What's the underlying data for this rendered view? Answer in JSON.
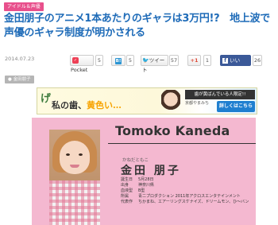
{
  "article": {
    "category": "アイドル＆声優",
    "title": "金田朋子のアニメ1本あたりのギャラは3万円!?　地上波で声優のギャラ制度が明かされる",
    "date": "2014.07.23",
    "tag": "金田朋子"
  },
  "share": {
    "pocket": {
      "label": "Pocket",
      "count": "5"
    },
    "hatena": {
      "icon": "B!",
      "count": "5"
    },
    "tweet": {
      "label": "ツイート",
      "count": "57"
    },
    "gplus": {
      "label": "+1",
      "count": "1"
    },
    "facebook": {
      "label": "いいね！",
      "count": "26"
    }
  },
  "ad": {
    "ke": "げ",
    "line_prefix": "私の歯、",
    "line_highlight": "黄色い…",
    "notice": "歯が黄ばんでいる人限定!!",
    "subtext": "京都やまみち",
    "button": "詳しくはこちら"
  },
  "profile": {
    "name_en": "Tomoko Kaneda",
    "furigana": "かねだともこ",
    "name_jp": "金田 朋子",
    "details": [
      {
        "key": "誕生日",
        "value": "5月28日"
      },
      {
        "key": "出身",
        "value": "神奈川県"
      },
      {
        "key": "血液型",
        "value": "B型"
      },
      {
        "key": "所属",
        "value": "青二プロダクション 2011年アクロスエンタテインメント"
      },
      {
        "key": "代表作",
        "value": "ちかまね、エアーリングスケナイズ、ドリームモン、ひ〜バン"
      }
    ]
  },
  "colors": {
    "title_blue": "#1e6bb8",
    "category_pink": "#e8508c",
    "profile_pink": "#f4b8d0",
    "pocket": "#ee4056",
    "hatena": "#2c95d3",
    "twitter": "#55acee",
    "gplus": "#dd4b39",
    "facebook": "#3b5998"
  }
}
